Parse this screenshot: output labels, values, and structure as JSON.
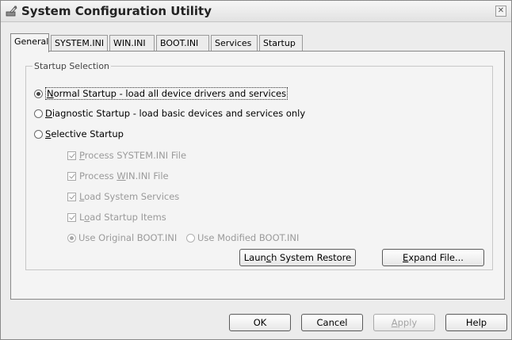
{
  "window": {
    "title": "System Configuration Utility",
    "close_glyph": "✕"
  },
  "tabs": [
    {
      "label": "General",
      "active": true
    },
    {
      "label": "SYSTEM.INI"
    },
    {
      "label": "WIN.INI"
    },
    {
      "label": "BOOT.INI"
    },
    {
      "label": "Services"
    },
    {
      "label": "Startup"
    }
  ],
  "startup": {
    "group_label": "Startup Selection",
    "normal": {
      "mnemonic": "N",
      "rest": "ormal Startup - load all device drivers and services",
      "selected": true
    },
    "diagnostic": {
      "mnemonic": "D",
      "rest": "iagnostic Startup - load basic devices and services only"
    },
    "selective": {
      "mnemonic": "S",
      "rest": "elective Startup"
    },
    "options": {
      "system_ini": {
        "pre": "",
        "mnemonic": "P",
        "rest": "rocess SYSTEM.INI File"
      },
      "win_ini": {
        "pre": "Process ",
        "mnemonic": "W",
        "rest": "IN.INI File"
      },
      "services": {
        "pre": "",
        "mnemonic": "L",
        "rest": "oad System Services"
      },
      "startup_items": {
        "pre": "L",
        "mnemonic": "o",
        "rest": "ad Startup Items"
      },
      "boot_original": "Use Original BOOT.INI",
      "boot_modified": "Use Modified BOOT.INI"
    }
  },
  "buttons": {
    "restore": {
      "pre": "Laun",
      "mnemonic": "c",
      "rest": "h System Restore"
    },
    "expand": {
      "pre": "",
      "mnemonic": "E",
      "rest": "xpand File..."
    },
    "ok": "OK",
    "cancel": "Cancel",
    "apply": {
      "mnemonic": "A",
      "rest": "pply"
    },
    "help": "Help"
  }
}
